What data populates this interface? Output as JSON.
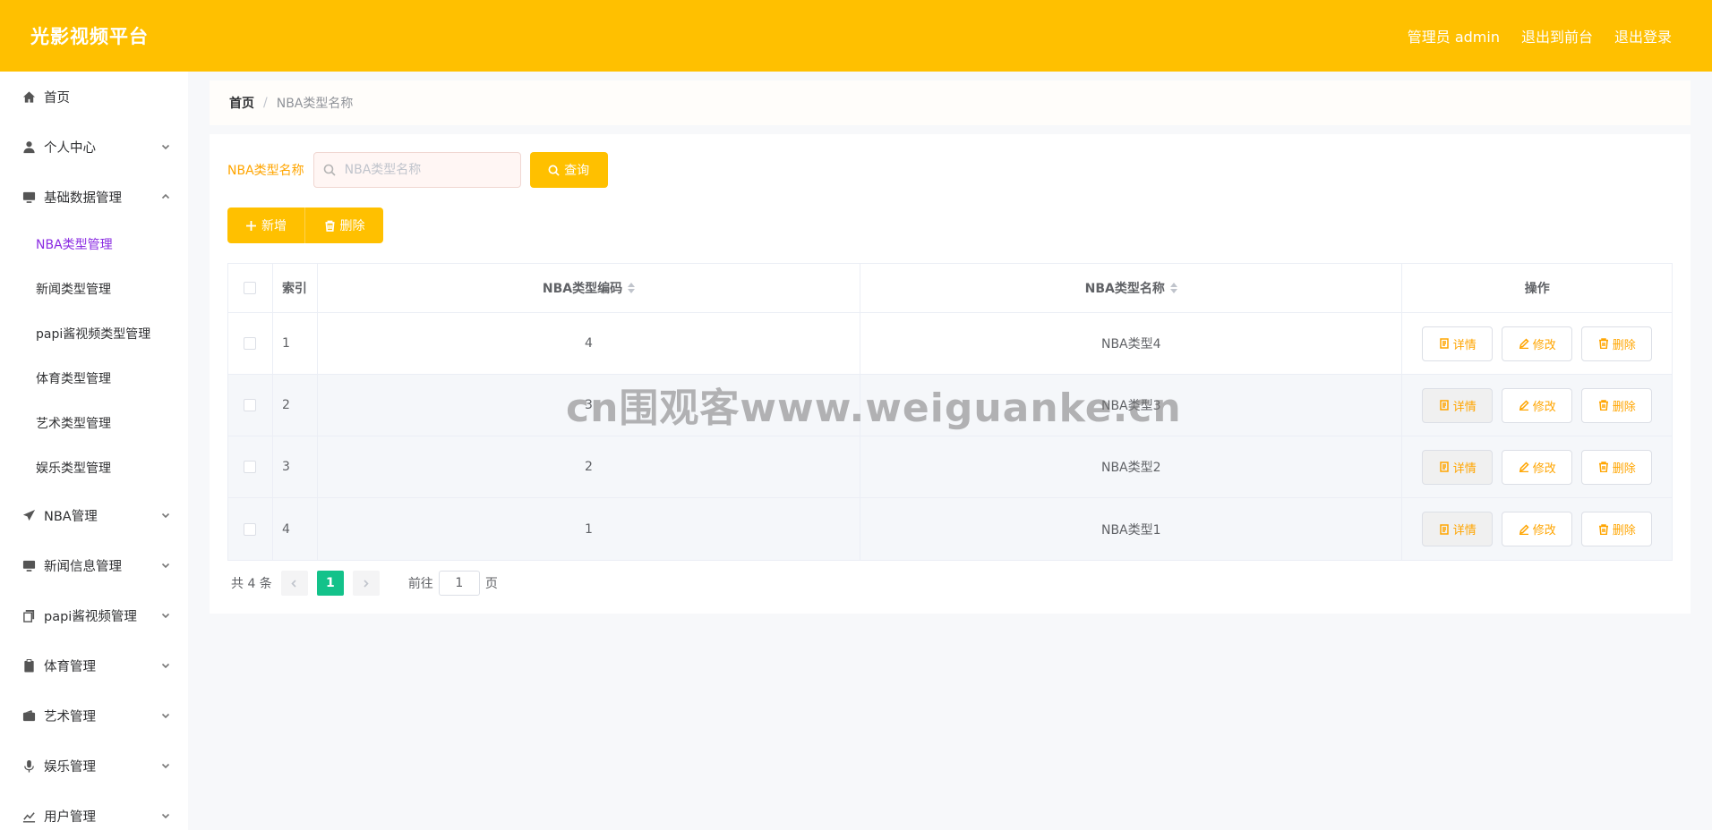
{
  "header": {
    "brand": "光影视频平台",
    "admin_label": "管理员 admin",
    "to_front": "退出到前台",
    "logout": "退出登录"
  },
  "sidebar": {
    "items": [
      {
        "label": "首页",
        "icon": "home-icon",
        "chevron": false
      },
      {
        "label": "个人中心",
        "icon": "user-icon",
        "chevron": "down"
      },
      {
        "label": "基础数据管理",
        "icon": "monitor-icon",
        "chevron": "up"
      },
      {
        "label": "NBA管理",
        "icon": "send-icon",
        "chevron": "down"
      },
      {
        "label": "新闻信息管理",
        "icon": "monitor-icon",
        "chevron": "down"
      },
      {
        "label": "papi酱视频管理",
        "icon": "copy-icon",
        "chevron": "down"
      },
      {
        "label": "体育管理",
        "icon": "clipboard-icon",
        "chevron": "down"
      },
      {
        "label": "艺术管理",
        "icon": "wallet-icon",
        "chevron": "down"
      },
      {
        "label": "娱乐管理",
        "icon": "microphone-icon",
        "chevron": "down"
      },
      {
        "label": "用户管理",
        "icon": "chart-icon",
        "chevron": "down"
      }
    ],
    "subitems": [
      {
        "label": "NBA类型管理",
        "active": true
      },
      {
        "label": "新闻类型管理",
        "active": false
      },
      {
        "label": "papi酱视频类型管理",
        "active": false
      },
      {
        "label": "体育类型管理",
        "active": false
      },
      {
        "label": "艺术类型管理",
        "active": false
      },
      {
        "label": "娱乐类型管理",
        "active": false
      }
    ]
  },
  "breadcrumb": {
    "home": "首页",
    "separator": "/",
    "current": "NBA类型名称"
  },
  "search": {
    "label": "NBA类型名称",
    "placeholder": "NBA类型名称",
    "button": "查询"
  },
  "actions": {
    "add": "新增",
    "delete": "删除"
  },
  "table": {
    "headers": {
      "index": "索引",
      "code": "NBA类型编码",
      "name": "NBA类型名称",
      "ops": "操作"
    },
    "rows": [
      {
        "index": "1",
        "code": "4",
        "name": "NBA类型4"
      },
      {
        "index": "2",
        "code": "3",
        "name": "NBA类型3"
      },
      {
        "index": "3",
        "code": "2",
        "name": "NBA类型2"
      },
      {
        "index": "4",
        "code": "1",
        "name": "NBA类型1"
      }
    ],
    "op_labels": {
      "detail": "详情",
      "edit": "修改",
      "delete": "删除"
    }
  },
  "pagination": {
    "total": "共 4 条",
    "current_page": "1",
    "goto_prefix": "前往",
    "goto_value": "1",
    "goto_suffix": "页"
  },
  "watermark": "cn围观客www.weiguanke.cn",
  "colors": {
    "accent": "#ffc000",
    "active_menu": "#8a2be2",
    "page_active": "#13c28a",
    "op_text": "#ffa500"
  }
}
